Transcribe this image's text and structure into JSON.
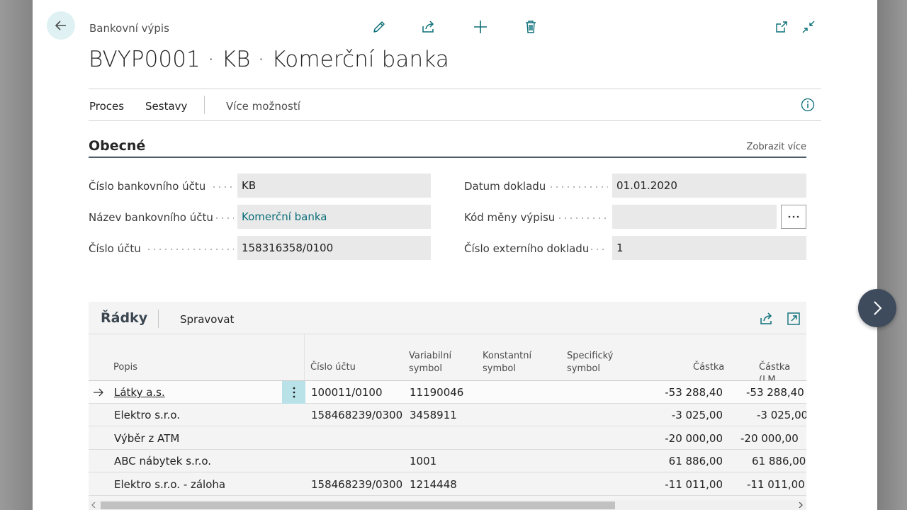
{
  "breadcrumb": "Bankovní výpis",
  "title": "BVYP0001 · KB · Komerční banka",
  "toolbar": {
    "icons": [
      "edit-icon",
      "share-icon",
      "add-icon",
      "delete-icon",
      "open-new-window-icon",
      "collapse-icon"
    ]
  },
  "actions": {
    "process": "Proces",
    "reports": "Sestavy",
    "more": "Více možností"
  },
  "general": {
    "title": "Obecné",
    "show_more": "Zobrazit více",
    "fields": {
      "bank_account_no": {
        "label": "Číslo bankovního účtu",
        "value": "KB"
      },
      "bank_account_name": {
        "label": "Název bankovního účtu",
        "value": "Komerční banka"
      },
      "account_no": {
        "label": "Číslo účtu",
        "value": "158316358/0100"
      },
      "document_date": {
        "label": "Datum dokladu",
        "value": "01.01.2020"
      },
      "currency_code": {
        "label": "Kód měny výpisu",
        "value": ""
      },
      "external_doc_no": {
        "label": "Číslo externího dokladu",
        "value": "1"
      }
    }
  },
  "lines": {
    "title": "Řádky",
    "manage": "Spravovat",
    "columns": {
      "description": "Popis",
      "account_no": "Číslo účtu",
      "variable_symbol": [
        "Variabilní",
        "symbol"
      ],
      "constant_symbol": [
        "Konstantní",
        "symbol"
      ],
      "specific_symbol": [
        "Specifický",
        "symbol"
      ],
      "amount": "Částka",
      "amount_lcy": "Částka (LM"
    },
    "rows": [
      {
        "description": "Látky a.s.",
        "account_no": "100011/0100",
        "variable_symbol": "11190046",
        "constant_symbol": "",
        "specific_symbol": "",
        "amount": "-53 288,40",
        "amount_lcy": "-53 288,40"
      },
      {
        "description": "Elektro s.r.o.",
        "account_no": "158468239/0300",
        "variable_symbol": "3458911",
        "constant_symbol": "",
        "specific_symbol": "",
        "amount": "-3 025,00",
        "amount_lcy": "-3 025,00"
      },
      {
        "description": "Výběr z ATM",
        "account_no": "",
        "variable_symbol": "",
        "constant_symbol": "",
        "specific_symbol": "",
        "amount": "-20 000,00",
        "amount_lcy": "-20 000,00"
      },
      {
        "description": "ABC nábytek s.r.o.",
        "account_no": "",
        "variable_symbol": "1001",
        "constant_symbol": "",
        "specific_symbol": "",
        "amount": "61 886,00",
        "amount_lcy": "61 886,00"
      },
      {
        "description": "Elektro s.r.o. - záloha",
        "account_no": "158468239/0300",
        "variable_symbol": "1214448",
        "constant_symbol": "",
        "specific_symbol": "",
        "amount": "-11 011,00",
        "amount_lcy": "-11 011,00"
      }
    ]
  },
  "colors": {
    "accent": "#0a6e78",
    "back_button_bg": "#dff1f3",
    "next_button_bg": "#3d4b5c",
    "field_bg": "#e9e9e9"
  }
}
